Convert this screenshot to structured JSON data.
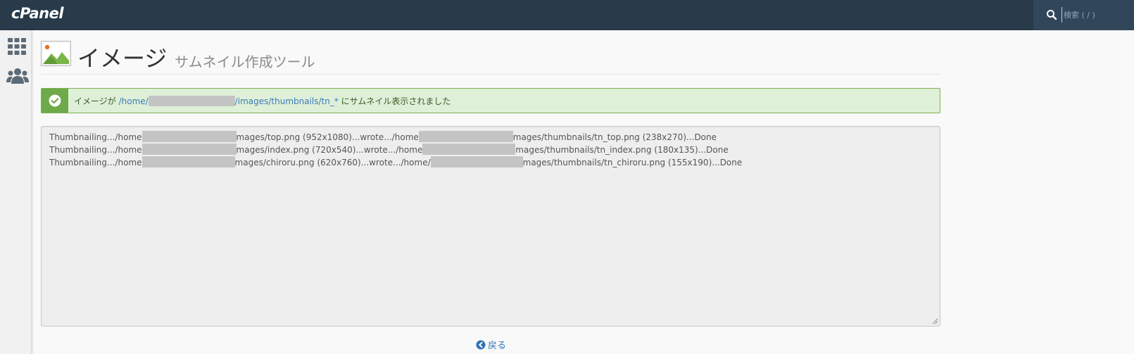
{
  "header": {
    "logo": "cPanel",
    "search_placeholder": "検索 ( / )"
  },
  "sidebar": {
    "items": [
      {
        "icon": "grid-icon",
        "label": ""
      },
      {
        "icon": "users-icon",
        "label": ""
      }
    ]
  },
  "page": {
    "title": "イメージ",
    "subtitle": "サムネイル作成ツール"
  },
  "alert": {
    "prefix": "イメージが ",
    "path_start": "/home/",
    "path_end": "/images/thumbnails/tn_*",
    "suffix": " にサムネイル表示されました",
    "color": "#6ea94a"
  },
  "log": {
    "lines": [
      {
        "a": "Thumbnailing.../home",
        "b": "mages/top.png (952x1080)...wrote.../home",
        "c": "mages/thumbnails/tn_top.png (238x270)...Done"
      },
      {
        "a": "Thumbnailing.../home",
        "b": "mages/index.png (720x540)...wrote.../home",
        "c": "mages/thumbnails/tn_index.png (180x135)...Done"
      },
      {
        "a": "Thumbnailing.../home",
        "b": "mages/chiroru.png (620x760)...wrote.../home/",
        "c": "mages/thumbnails/tn_chiroru.png (155x190)...Done"
      }
    ]
  },
  "footer": {
    "back_label": "戻る"
  }
}
